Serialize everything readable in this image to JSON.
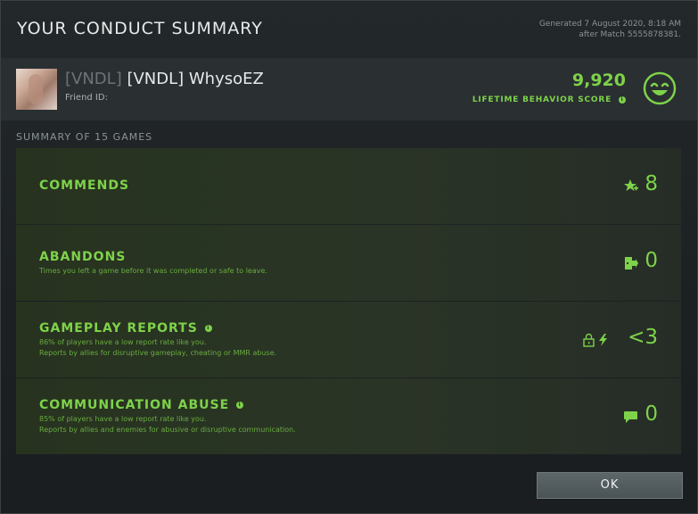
{
  "header": {
    "title": "YOUR CONDUCT SUMMARY",
    "generated_line1": "Generated 7 August 2020, 8:18 AM",
    "generated_line2": "after Match 5555878381."
  },
  "profile": {
    "tag_dim": "[VNDL]",
    "name": "[VNDL] WhysoEZ",
    "friend_id_label": "Friend ID:",
    "score": "9,920",
    "score_label": "LIFETIME BEHAVIOR SCORE",
    "score_info_icon": "info-icon",
    "mood_icon": "smiley-face-icon"
  },
  "summary_label": "SUMMARY OF 15 GAMES",
  "cards": [
    {
      "title": "COMMENDS",
      "lines": [],
      "value": "8",
      "icons": [
        "star-plus-icon"
      ]
    },
    {
      "title": "ABANDONS",
      "lines": [
        "Times you left a game before it was completed or safe to leave."
      ],
      "value": "0",
      "icons": [
        "exit-door-icon"
      ]
    },
    {
      "title": "GAMEPLAY REPORTS",
      "lines": [
        "86% of players have a low report rate like you.",
        "Reports by allies for disruptive gameplay, cheating or MMR abuse."
      ],
      "value": "<3",
      "icons": [
        "lock-icon",
        "lightning-icon"
      ]
    },
    {
      "title": "COMMUNICATION ABUSE",
      "lines": [
        "85% of players have a low report rate like you.",
        "Reports by allies and enemies for abusive or disruptive communication."
      ],
      "value": "0",
      "icons": [
        "chat-bubble-icon"
      ]
    }
  ],
  "ok_label": "OK",
  "colors": {
    "accent": "#7ed24a",
    "card_bg": "#2a3426",
    "background": "#1c2022"
  }
}
